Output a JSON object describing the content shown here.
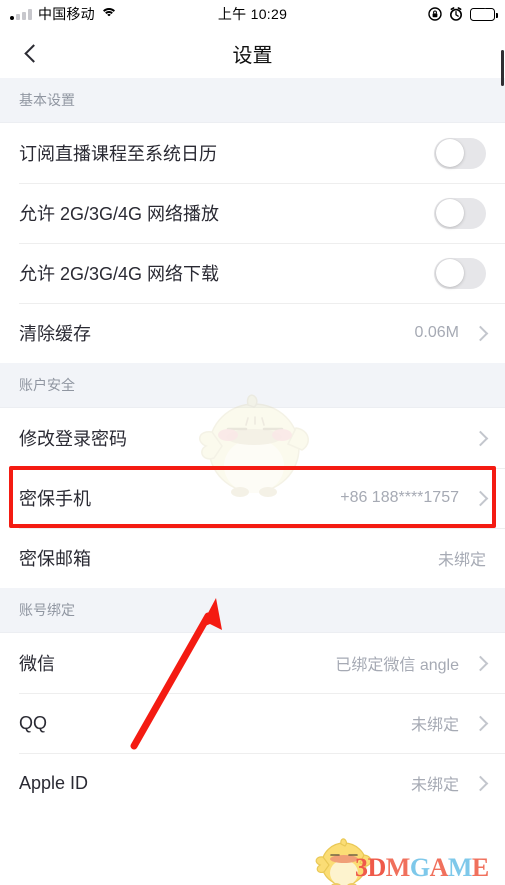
{
  "status_bar": {
    "carrier": "中国移动",
    "time": "上午 10:29",
    "signal_icon": "signal-bars-icon",
    "wifi_icon": "wifi-icon",
    "rotation_lock_icon": "rotation-lock-icon",
    "alarm_icon": "alarm-clock-icon",
    "battery_icon": "battery-charging-icon",
    "battery_color": "#4cd964"
  },
  "navbar": {
    "title": "设置",
    "back_icon": "back-chevron-icon"
  },
  "sections": [
    {
      "header": "基本设置",
      "rows": [
        {
          "label": "订阅直播课程至系统日历",
          "type": "toggle",
          "value": "",
          "on": false
        },
        {
          "label": "允许 2G/3G/4G 网络播放",
          "type": "toggle",
          "value": "",
          "on": false
        },
        {
          "label": "允许 2G/3G/4G 网络下载",
          "type": "toggle",
          "value": "",
          "on": false
        },
        {
          "label": "清除缓存",
          "type": "value",
          "value": "0.06M",
          "chevron": true
        }
      ]
    },
    {
      "header": "账户安全",
      "rows": [
        {
          "label": "修改登录密码",
          "type": "value",
          "value": "",
          "chevron": true
        },
        {
          "label": "密保手机",
          "type": "value",
          "value": "+86 188****1757",
          "chevron": true,
          "highlighted": true
        },
        {
          "label": "密保邮箱",
          "type": "value",
          "value": "未绑定",
          "chevron": false
        }
      ]
    },
    {
      "header": "账号绑定",
      "rows": [
        {
          "label": "微信",
          "type": "value",
          "value": "已绑定微信 angle",
          "chevron": true
        },
        {
          "label": "QQ",
          "type": "value",
          "value": "未绑定",
          "chevron": true
        },
        {
          "label": "Apple ID",
          "type": "value",
          "value": "未绑定",
          "chevron": true
        }
      ]
    }
  ],
  "annotations": {
    "highlight_color": "#f41b12",
    "arrow_color": "#f41b12",
    "highlight_target": "密保手机",
    "arrow_points_to": "密保手机"
  },
  "watermark": {
    "brand_text": "3DMGAME",
    "brand_letters": [
      {
        "char": "3",
        "color": "#ef5a4a"
      },
      {
        "char": "D",
        "color": "#ef5a4a"
      },
      {
        "char": "M",
        "color": "#f0705c"
      },
      {
        "char": "G",
        "color": "#7ec8ea"
      },
      {
        "char": "A",
        "color": "#f0705c"
      },
      {
        "char": "M",
        "color": "#7ec8ea"
      },
      {
        "char": "E",
        "color": "#f0705c"
      }
    ],
    "chick_icon": "chick-mascot-icon"
  }
}
